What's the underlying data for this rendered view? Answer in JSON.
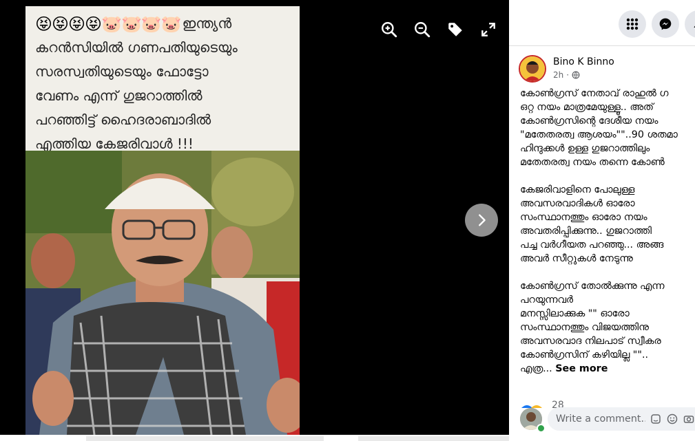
{
  "viewer": {
    "caption_emojis": "😝😝😝😝🐷🐷🐷🐷",
    "caption_lines": [
      "ഇന്ത്യൻ",
      "കറൻസിയിൽ ഗണപതിയുടെയും",
      "സരസ്വതിയുടെയും ഫോട്ടോ",
      "വേണം എന്ന് ഗുജറാത്തിൽ",
      "പറഞ്ഞിട്ട് ഹൈദരാബാദിൽ",
      "എത്തിയ കേജരിവാൾ !!!"
    ],
    "toolbar": [
      "zoom-in-icon",
      "zoom-out-icon",
      "tag-icon",
      "fullscreen-icon"
    ],
    "next_icon": "chevron-right-icon"
  },
  "panel": {
    "top_buttons": [
      "apps-grid-icon",
      "messenger-icon",
      "notifications-icon"
    ],
    "author": "Bino K Binno",
    "time": "2h",
    "privacy_icon": "globe-icon",
    "paragraphs": [
      [
        "കോൺഗ്രസ് നേതാവ് രാഹുൽ ഗ",
        "ഒറ്റ നയം മാത്രമേയുള്ളൂ.. അത്",
        "കോൺഗ്രസിന്റെ ദേശീയ നയം",
        "\"മതേതരത്വ ആശയം\"\"..90 ശതമാ",
        "ഹിന്ദുക്കൾ ഉള്ള ഗുജറാത്തിലും",
        "മതേതരത്വ നയം തന്നെ കോൺ"
      ],
      [
        "കേജരിവാളിനെ പോലുള്ള",
        "അവസരവാദികൾ ഓരോ",
        "സംസ്ഥാനത്തും ഓരോ നയം",
        "അവതരിപ്പിക്കുന്നു.. ഗുജറാത്തി",
        "പച്ച വർഗീയത പറഞ്ഞു... അങ്ങ",
        "അവർ സീറ്റുകൾ നേടുന്നു"
      ],
      [
        "കോൺഗ്രസ് തോൽക്കുന്നു എന്ന",
        "പറയുന്നവർ",
        "മനസ്സിലാക്കുക \"\" ഓരോ",
        "സംസ്ഥാനത്തും വിജയത്തിനു ",
        "അവസരവാദ നിലപാട് സ്വീകര",
        "കോൺഗ്രസിന് കഴിയില്ല \"\".."
      ]
    ],
    "last_line_prefix": "എത്ര...",
    "see_more": "See more",
    "reaction_count": "28",
    "comment_placeholder": "Write a comment...",
    "comment_icons": [
      "sticker-icon",
      "emoji-icon",
      "camera-icon"
    ]
  }
}
